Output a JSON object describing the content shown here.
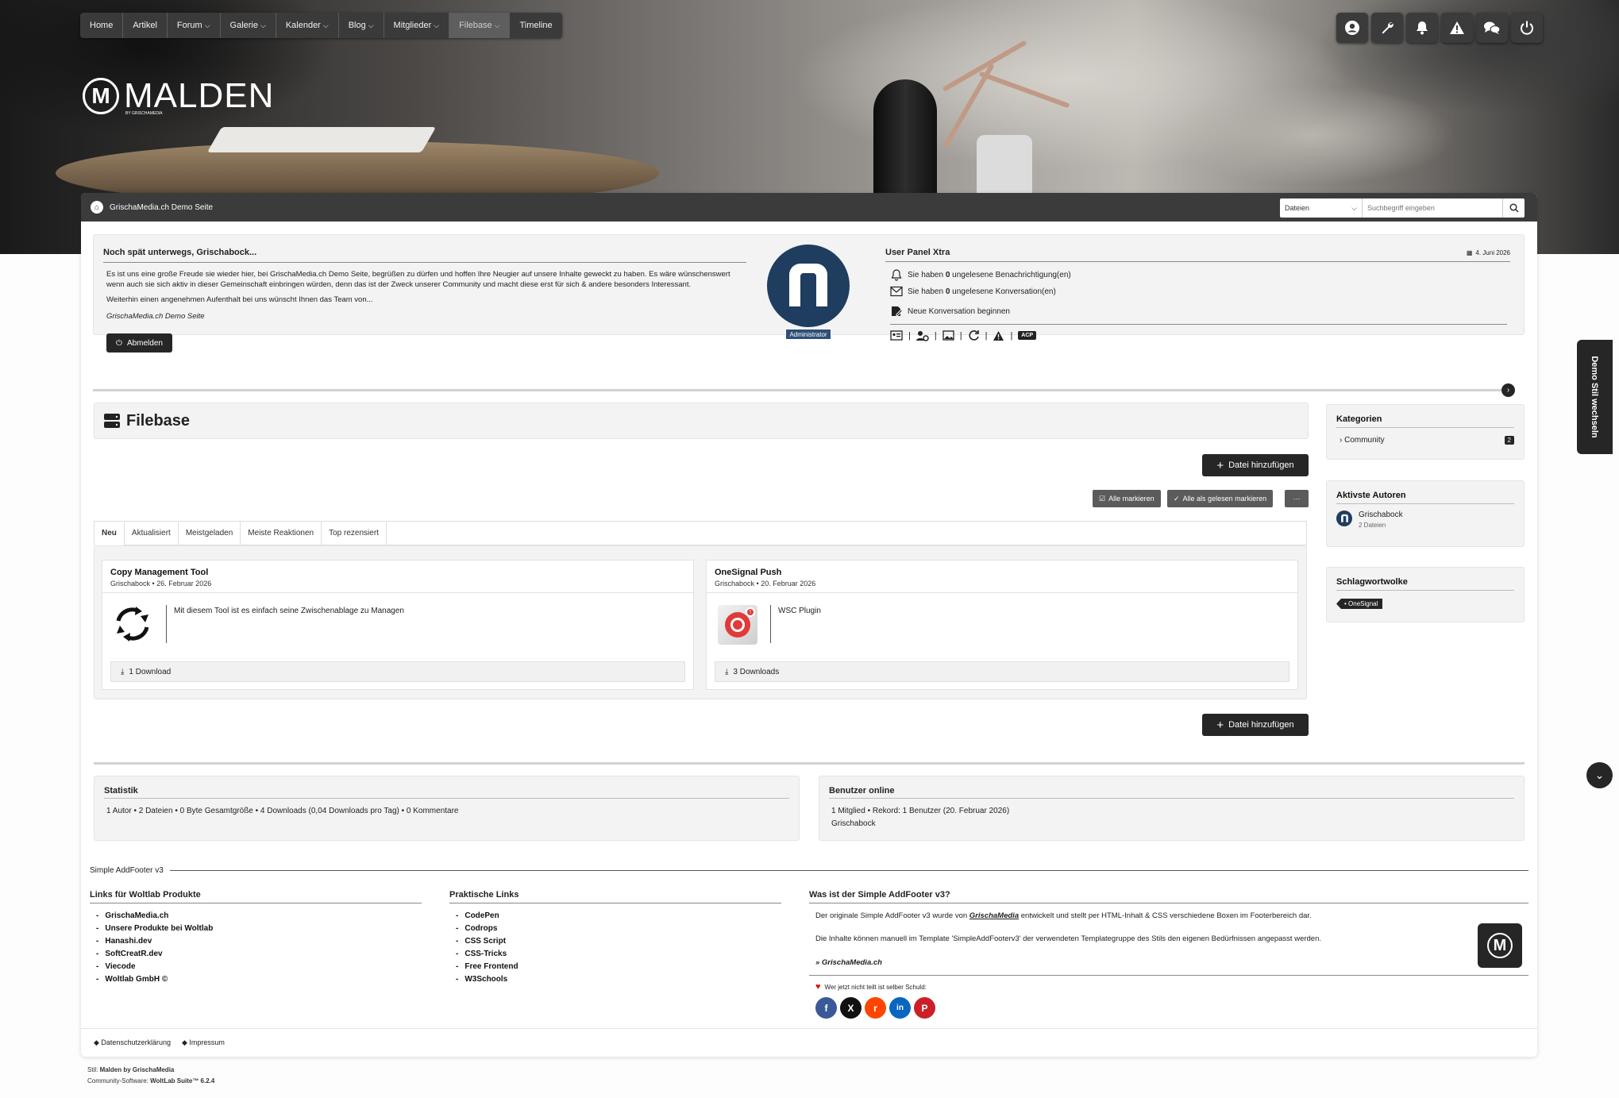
{
  "nav": {
    "items": [
      {
        "label": "Home",
        "dropdown": false
      },
      {
        "label": "Artikel",
        "dropdown": false
      },
      {
        "label": "Forum",
        "dropdown": true
      },
      {
        "label": "Galerie",
        "dropdown": true
      },
      {
        "label": "Kalender",
        "dropdown": true
      },
      {
        "label": "Blog",
        "dropdown": true
      },
      {
        "label": "Mitglieder",
        "dropdown": true
      },
      {
        "label": "Filebase",
        "dropdown": true,
        "active": true
      },
      {
        "label": "Timeline",
        "dropdown": false
      }
    ]
  },
  "usernav_icons": [
    "user-icon",
    "wrench-icon",
    "bell-icon",
    "warning-icon",
    "conversation-icon",
    "power-icon"
  ],
  "logo": {
    "text": "MALDEN",
    "subtitle": "BY GRISCHAMEDIA",
    "mark": "M"
  },
  "breadcrumb": {
    "label": "GrischaMedia.ch Demo Seite"
  },
  "search": {
    "scope": "Dateien",
    "placeholder": "Suchbegriff eingeben"
  },
  "welcome": {
    "title": "Noch spät unterwegs, Grischabock...",
    "paragraph1": "Es ist uns eine große Freude sie wieder hier, bei GrischaMedia.ch Demo Seite, begrüßen zu dürfen und hoffen Ihre Neugier auf unsere Inhalte geweckt zu haben. Es wäre wünschenswert wenn auch sie sich aktiv in dieser Gemeinschaft einbringen würden, denn das ist der Zweck unserer Community und macht diese erst für sich & andere besonders Interessant.",
    "paragraph2": "Weiterhin einen angenehmen Aufenthalt bei uns wünscht Ihnen das Team von...",
    "signature": "GrischaMedia.ch Demo Seite",
    "logout_label": "Abmelden"
  },
  "avatar": {
    "role": "Administrator"
  },
  "userpanel": {
    "title": "User Panel Xtra",
    "date": "4. Juni 2026",
    "notifications_pre": "Sie haben ",
    "notifications_count": "0",
    "notifications_post": " ungelesene Benachrichtigung(en)",
    "conversations_pre": "Sie haben ",
    "conversations_count": "0",
    "conversations_post": " ungelesene Konversation(en)",
    "new_conversation": "Neue Konversation beginnen",
    "acp_label": "ACP"
  },
  "filebase": {
    "title": "Filebase",
    "add_label": "Datei hinzufügen",
    "mark_all": "Alle markieren",
    "mark_read": "Alle als gelesen markieren",
    "more": "···",
    "tabs": [
      "Neu",
      "Aktualisiert",
      "Meistgeladen",
      "Meiste Reaktionen",
      "Top rezensiert"
    ],
    "files": [
      {
        "title": "Copy Management Tool",
        "author": "Grischabock",
        "date": "26. Februar 2026",
        "description": "Mit diesem Tool ist es einfach seine Zwischenablage zu Managen",
        "downloads": "1 Download"
      },
      {
        "title": "OneSignal Push",
        "author": "Grischabock",
        "date": "20. Februar 2026",
        "description": "WSC Plugin",
        "downloads": "3 Downloads"
      }
    ]
  },
  "sidebar": {
    "categories": {
      "title": "Kategorien",
      "items": [
        {
          "label": "Community",
          "count": "2"
        }
      ]
    },
    "authors": {
      "title": "Aktivste Autoren",
      "items": [
        {
          "name": "Grischabock",
          "files": "2 Dateien"
        }
      ]
    },
    "tags": {
      "title": "Schlagwortwolke",
      "items": [
        "OneSignal"
      ]
    }
  },
  "stats": {
    "title": "Statistik",
    "text": "1 Autor • 2 Dateien • 0 Byte Gesamtgröße • 4 Downloads (0,04 Downloads pro Tag) • 0 Kommentare"
  },
  "online": {
    "title": "Benutzer online",
    "text": "1 Mitglied • Rekord: 1 Benutzer (20. Februar 2026)",
    "users": "Grischabock"
  },
  "footer": {
    "title": "Simple AddFooter v3",
    "col1": {
      "title": "Links für Woltlab Produkte",
      "links": [
        "GrischaMedia.ch",
        "Unsere Produkte bei Woltlab",
        "Hanashi.dev",
        "SoftCreatR.dev",
        "Viecode",
        "Woltlab GmbH ©"
      ]
    },
    "col2": {
      "title": "Praktische Links",
      "links": [
        "CodePen",
        "Codrops",
        "CSS Script",
        "CSS-Tricks",
        "Free Frontend",
        "W3Schools"
      ]
    },
    "col3": {
      "title": "Was ist der Simple AddFooter v3?",
      "text1_pre": "Der originale Simple AddFooter v3 wurde von ",
      "text1_brand": "GrischaMedia",
      "text1_post": " entwickelt und stellt per HTML-Inhalt & CSS verschiedene Boxen im Footerbereich dar.",
      "text2": "Die Inhalte können manuell im Template 'SimpleAddFooterv3' der verwendeten Templategruppe des Stils den eigenen Bedürfnissen angepasst werden.",
      "link": "» GrischaMedia.ch",
      "share_text": "Wer jetzt nicht teilt ist selber Schuld:"
    },
    "social": [
      {
        "name": "facebook-icon",
        "glyph": "f",
        "color": "#3b5998"
      },
      {
        "name": "x-icon",
        "glyph": "X",
        "color": "#111111"
      },
      {
        "name": "reddit-icon",
        "glyph": "r",
        "color": "#ff4500"
      },
      {
        "name": "linkedin-icon",
        "glyph": "in",
        "color": "#0a66c2"
      },
      {
        "name": "pinterest-icon",
        "glyph": "P",
        "color": "#cb2027"
      }
    ],
    "legal": [
      "Datenschutzerklärung",
      "Impressum"
    ],
    "style_label": "Stil: ",
    "style_value": "Malden by GrischaMedia",
    "software_label": "Community-Software: ",
    "software_value": "WoltLab Suite™ 6.2.4"
  },
  "style_switcher": "Demo Stil wechseln"
}
